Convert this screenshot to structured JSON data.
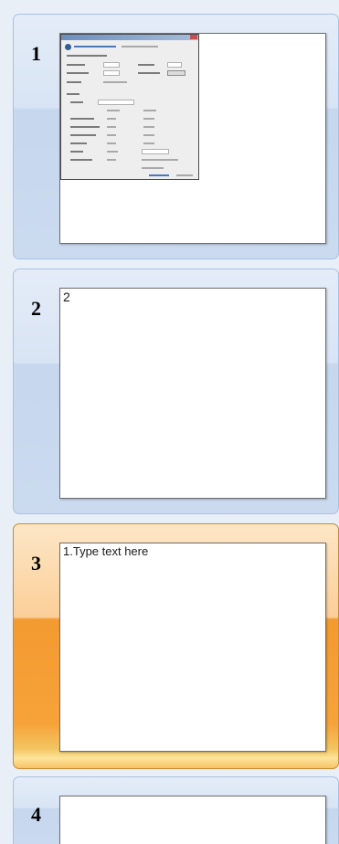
{
  "slides_panel": {
    "slides": [
      {
        "number": "1",
        "text": "",
        "selected": false
      },
      {
        "number": "2",
        "text": "2",
        "selected": false
      },
      {
        "number": "3",
        "text": "1.Type text here",
        "selected": true
      },
      {
        "number": "4",
        "text": "",
        "selected": false
      }
    ]
  },
  "colors": {
    "panel_bg": "#e9eff7",
    "item_border": "#a9c1e1",
    "selected_orange": "#f39a30",
    "selected_border": "#c98a34"
  }
}
